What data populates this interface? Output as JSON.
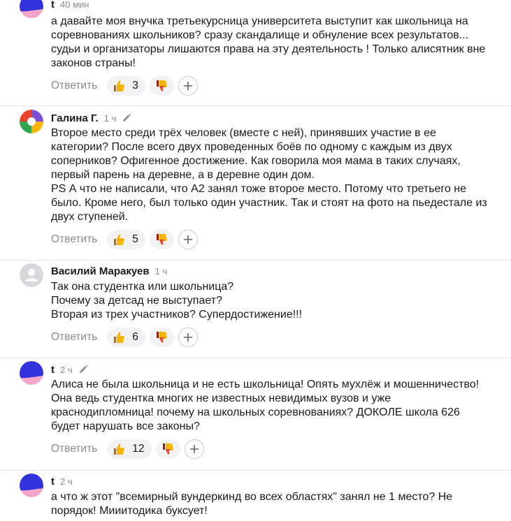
{
  "comments": [
    {
      "author": "t",
      "time": "40 мин",
      "edited": false,
      "avatar": "blue",
      "text": "а давайте моя внучка третьекурсница университета выступит как школьница на\nсоревнованиях школьников? сразу скандалище и обнуление всех результатов...\nсудьи и организаторы лишаются права на эту деятельность ! Только алисятник вне\nзаконов страны!",
      "reply_label": "Ответить",
      "likes": "3"
    },
    {
      "author": "Галина Г.",
      "time": "1 ч",
      "edited": true,
      "avatar": "segments",
      "text": "Второе место среди трёх человек (вместе с ней), принявших участие в ее\nкатегории? После всего двух проведенных боёв по одному с каждым из двух\nсоперников? Офигенное достижение. Как говорила моя мама в таких случаях,\nпервый парень на деревне, а в деревне один дом.\nPS А что не написали, что А2 занял тоже второе место. Потому что третьего не\nбыло. Кроме него, был только один участник. Так и стоят на фото на пьедестале из\nдвух ступеней.",
      "reply_label": "Ответить",
      "likes": "5"
    },
    {
      "author": "Василий Маракуев",
      "time": "1 ч",
      "edited": false,
      "avatar": "placeholder",
      "text": "Так она студентка или школьница?\nПочему за детсад не выступает?\nВторая из трех участников? Супердостижение!!!",
      "reply_label": "Ответить",
      "likes": "6"
    },
    {
      "author": "t",
      "time": "2 ч",
      "edited": true,
      "avatar": "blue",
      "text": "Алиса не была школьница и не есть школьница! Опять мухлёж и мошенничество!\nОна ведь студентка многих не известных невидимых вузов и уже\nкраснодипломница! почему на школьных соревнованиях? ДОКОЛЕ школа 626\nбудет нарушать все законы?",
      "reply_label": "Ответить",
      "likes": "12"
    },
    {
      "author": "t",
      "time": "2 ч",
      "edited": false,
      "avatar": "blue",
      "text": "а что ж этот \"всемирный вундеркинд во всех областях\" занял не 1 место? Не\nпорядок! Мииитодика буксует!",
      "reply_label": "",
      "likes": ""
    }
  ],
  "colors": {
    "accent_blue": "#3333dd",
    "avatar_pink": "#f4a6c8",
    "like_yellow": "#f5b400",
    "dislike_red": "#e8452c"
  },
  "icons": {
    "like": "thumbs-up-icon",
    "dislike": "thumbs-down-icon",
    "add": "plus-icon",
    "edit": "pencil-icon"
  }
}
